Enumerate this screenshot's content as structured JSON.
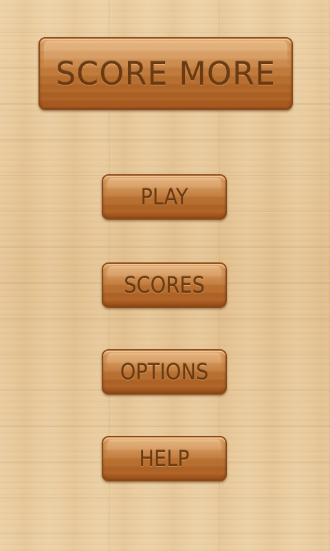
{
  "title": "SCORE MORE",
  "menu": {
    "play": "PLAY",
    "scores": "SCORES",
    "options": "OPTIONS",
    "help": "HELP"
  },
  "colors": {
    "background_wood": "#e7c79a",
    "button_wood": "#c98444",
    "button_text": "#6a3a12",
    "button_border": "#8a4a18"
  }
}
